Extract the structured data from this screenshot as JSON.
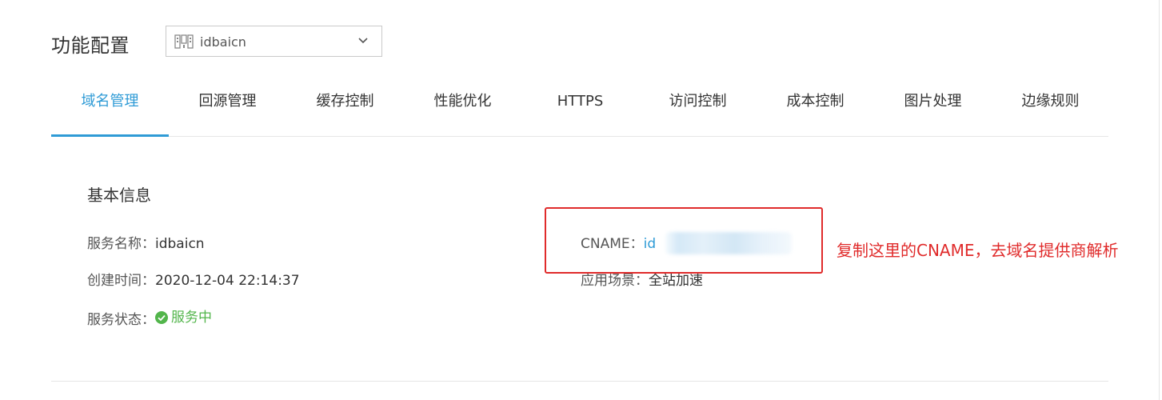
{
  "header": {
    "title": "功能配置",
    "domain_select": {
      "value": "idbaicn",
      "icon": "domain-grid-icon",
      "chevron": "chevron-down-icon"
    }
  },
  "tabs": [
    {
      "label": "域名管理",
      "active": true
    },
    {
      "label": "回源管理",
      "active": false
    },
    {
      "label": "缓存控制",
      "active": false
    },
    {
      "label": "性能优化",
      "active": false
    },
    {
      "label": "HTTPS",
      "active": false
    },
    {
      "label": "访问控制",
      "active": false
    },
    {
      "label": "成本控制",
      "active": false
    },
    {
      "label": "图片处理",
      "active": false
    },
    {
      "label": "边缘规则",
      "active": false
    }
  ],
  "basic_info": {
    "section_title": "基本信息",
    "service_name_label": "服务名称：",
    "service_name_value": "idbaicn",
    "created_label": "创建时间：",
    "created_value": "2020-12-04 22:14:37",
    "status_label": "服务状态：",
    "status_value": "服务中",
    "status_icon": "check-circle-icon",
    "cname_label": "CNAME：",
    "cname_value_visible": "id",
    "scene_label": "应用场景：",
    "scene_value": "全站加速"
  },
  "annotation": {
    "text": "复制这里的CNAME，去域名提供商解析"
  },
  "colors": {
    "accent": "#2f9bd6",
    "success": "#52b54b",
    "annotation": "#e02b2b"
  }
}
